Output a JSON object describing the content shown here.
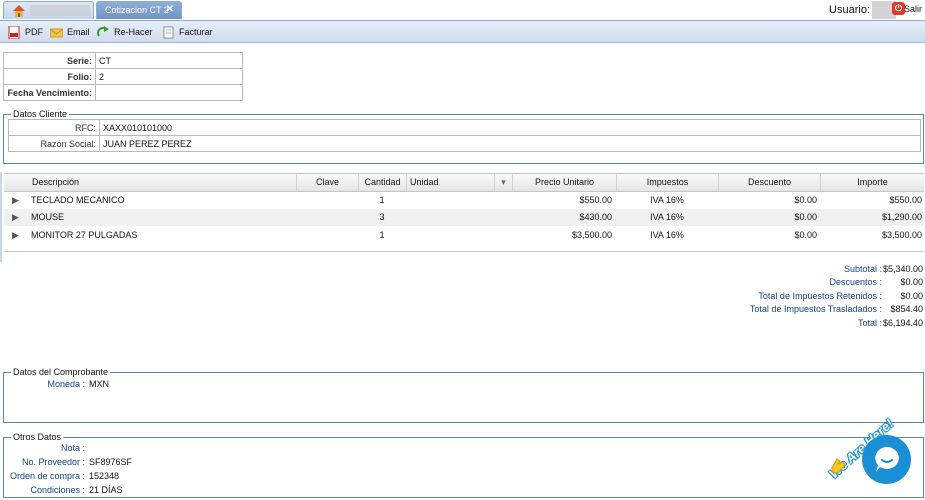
{
  "tabs": [
    {
      "label": ""
    },
    {
      "label": "Cotizacion CT 2",
      "close": "✕"
    }
  ],
  "header": {
    "usuario_label": "Usuario:",
    "salir": "Salir"
  },
  "toolbar": {
    "pdf": "PDF",
    "email": "Email",
    "rehacer": "Re-Hacer",
    "facturar": "Facturar"
  },
  "doc": {
    "serie_label": "Serie:",
    "serie": "CT",
    "folio_label": "Folio:",
    "folio": "2",
    "venc_label": "Fecha Vencimiento:",
    "venc": ""
  },
  "cliente": {
    "legend": "Datos Cliente",
    "rfc_label": "RFC:",
    "rfc": "XAXX010101000",
    "razon_label": "Razón Social:",
    "razon": "JUAN PEREZ PEREZ"
  },
  "grid": {
    "headers": {
      "descripcion": "Descripción",
      "clave": "Clave",
      "cantidad": "Cantidad",
      "unidad": "Unidad",
      "precio": "Precio Unitario",
      "impuestos": "Impuestos",
      "descuento": "Descuento",
      "importe": "Importe"
    },
    "rows": [
      {
        "descripcion": "TECLADO MECANICO",
        "clave": "",
        "cantidad": "1",
        "unidad": "",
        "precio": "$550.00",
        "impuestos": "IVA 16%",
        "descuento": "$0.00",
        "importe": "$550.00"
      },
      {
        "descripcion": "MOUSE",
        "clave": "",
        "cantidad": "3",
        "unidad": "",
        "precio": "$430.00",
        "impuestos": "IVA 16%",
        "descuento": "$0.00",
        "importe": "$1,290.00"
      },
      {
        "descripcion": "MONITOR 27 PULGADAS",
        "clave": "",
        "cantidad": "1",
        "unidad": "",
        "precio": "$3,500.00",
        "impuestos": "IVA 16%",
        "descuento": "$0.00",
        "importe": "$3,500.00"
      }
    ]
  },
  "totals": [
    {
      "label": "Subtotal :",
      "value": "$5,340.00"
    },
    {
      "label": "Descuentos :",
      "value": "$0.00"
    },
    {
      "label": "Total de Impuestos Retenidos :",
      "value": "$0.00"
    },
    {
      "label": "Total de Impuestos Trasladados :",
      "value": "$854.40"
    },
    {
      "label": "Total :",
      "value": "$6,194.40"
    }
  ],
  "comprobante": {
    "legend": "Datos del Comprobante",
    "moneda_label": "Moneda :",
    "moneda": "MXN"
  },
  "otros": {
    "legend": "Otros Datos",
    "items": [
      {
        "label": "Nota :",
        "value": ""
      },
      {
        "label": "No. Proveedor :",
        "value": "SF8976SF"
      },
      {
        "label": "Orden de compra :",
        "value": "152348"
      },
      {
        "label": "Condiciones :",
        "value": "21 DÍAS"
      }
    ]
  },
  "chat": {
    "text": "We Are Here!"
  },
  "colors": {
    "accent": "#15428b",
    "tab_active": "#7a9cc9",
    "chat": "#1a8fd6"
  }
}
